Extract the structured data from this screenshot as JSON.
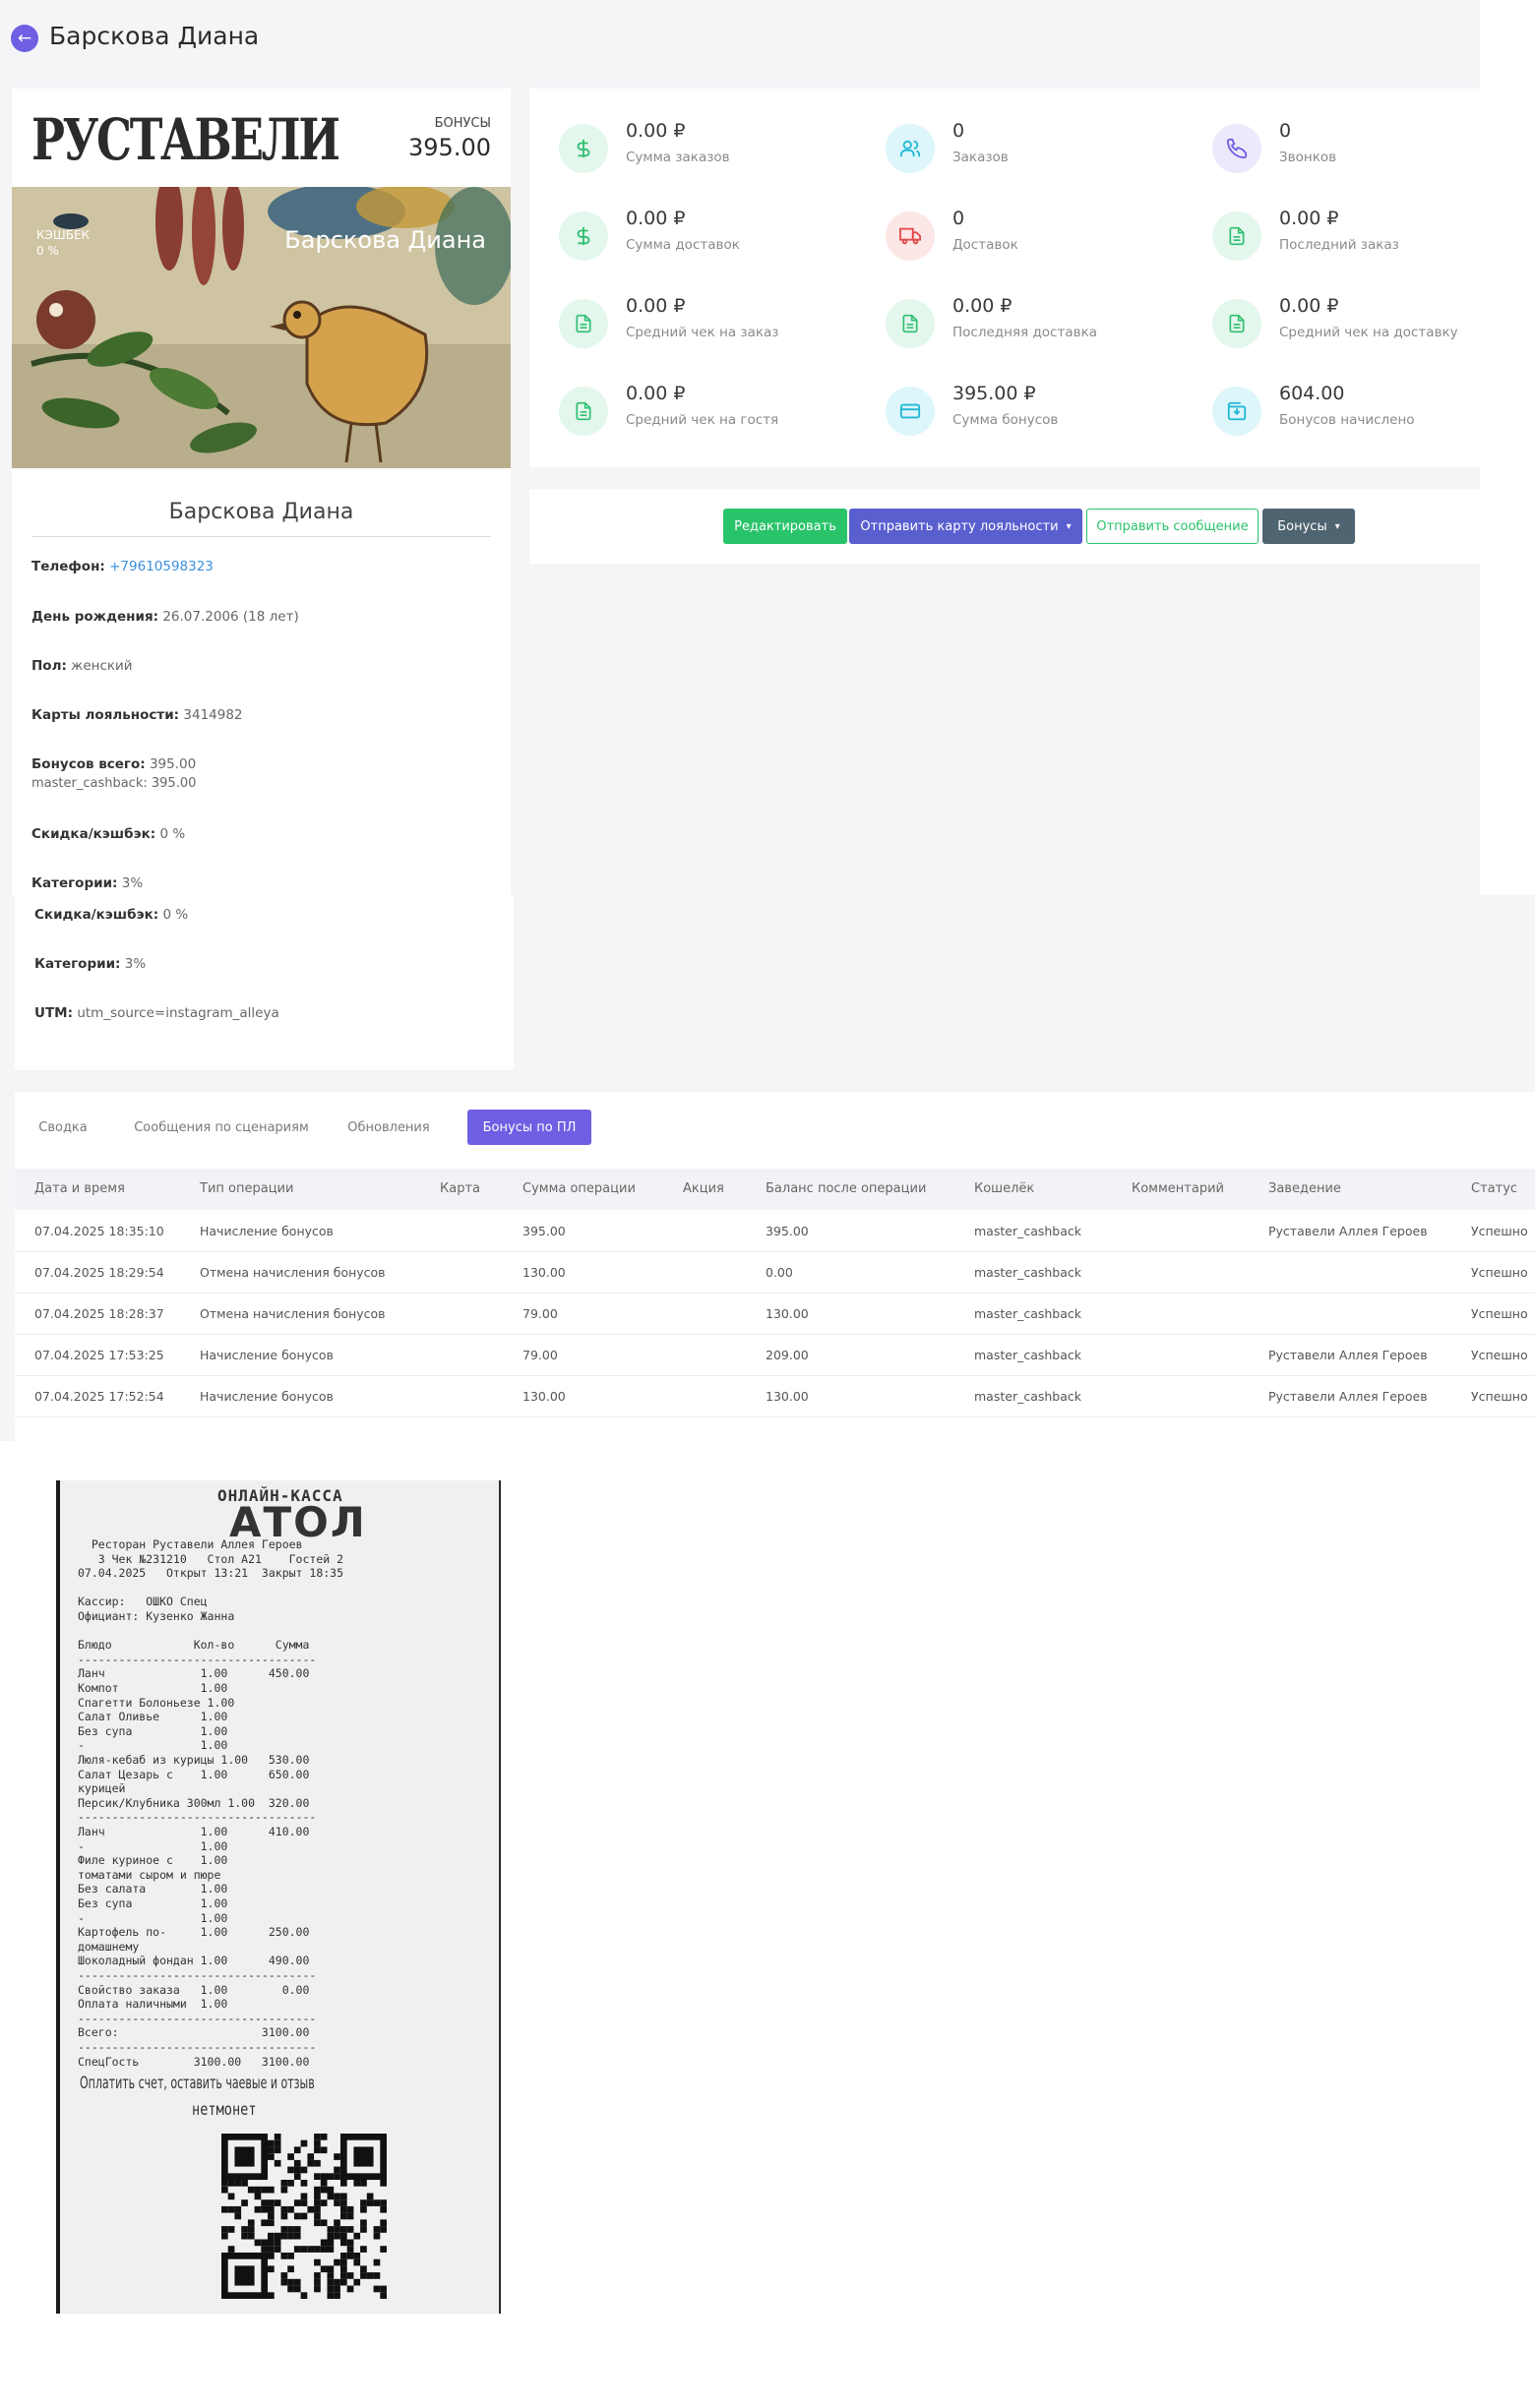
{
  "header": {
    "title": "Барскова Диана",
    "back_icon": "arrow-left-icon"
  },
  "loyalty_card": {
    "brand": "РУСТАВЕЛИ",
    "bonus_caption": "БОНУСЫ",
    "bonus_value": "395.00",
    "cashback_label": "КЭШБЕК",
    "cashback_value": "0 %",
    "holder": "Барскова Диана"
  },
  "profile": {
    "name": "Барскова Диана",
    "phone_label": "Телефон:",
    "phone": "+79610598323",
    "birthday_label": "День рождения:",
    "birthday": "26.07.2006 (18 лет)",
    "gender_label": "Пол:",
    "gender": "женский",
    "cards_label": "Карты лояльности:",
    "cards": "3414982",
    "bonus_total_label": "Бонусов всего:",
    "bonus_total": "395.00",
    "bonus_wallet": "master_cashback: 395.00",
    "discount_label": "Скидка/кэшбэк:",
    "discount": "0 %",
    "categories_label": "Категории:",
    "categories": "3%",
    "utm_label": "UTM:",
    "utm": "utm_source=instagram_alleya"
  },
  "stats": [
    {
      "value": "0.00 ₽",
      "label": "Сумма заказов",
      "icon": "dollar-icon",
      "color": "green"
    },
    {
      "value": "0",
      "label": "Заказов",
      "icon": "users-icon",
      "color": "cyan"
    },
    {
      "value": "0",
      "label": "Звонков",
      "icon": "phone-icon",
      "color": "purple"
    },
    {
      "value": "0.00 ₽",
      "label": "Сумма доставок",
      "icon": "dollar-icon",
      "color": "green"
    },
    {
      "value": "0",
      "label": "Доставок",
      "icon": "truck-icon",
      "color": "red"
    },
    {
      "value": "0.00 ₽",
      "label": "Последний заказ",
      "icon": "document-icon",
      "color": "green"
    },
    {
      "value": "0.00 ₽",
      "label": "Средний чек на заказ",
      "icon": "document-icon",
      "color": "green"
    },
    {
      "value": "0.00 ₽",
      "label": "Последняя доставка",
      "icon": "document-icon",
      "color": "green"
    },
    {
      "value": "0.00 ₽",
      "label": "Средний чек на доставку",
      "icon": "document-icon",
      "color": "green"
    },
    {
      "value": "0.00 ₽",
      "label": "Средний чек на гостя",
      "icon": "document-icon",
      "color": "green"
    },
    {
      "value": "395.00 ₽",
      "label": "Сумма бонусов",
      "icon": "credit-card-icon",
      "color": "cyan"
    },
    {
      "value": "604.00",
      "label": "Бонусов начислено",
      "icon": "wallet-icon",
      "color": "cyan"
    }
  ],
  "actions": {
    "edit": "Редактировать",
    "send_card": "Отправить карту лояльности",
    "send_message": "Отправить сообщение",
    "bonuses": "Бонусы"
  },
  "tabs": [
    "Сводка",
    "Сообщения по сценариям",
    "Обновления",
    "Бонусы по ПЛ"
  ],
  "table": {
    "columns": [
      "Дата и время",
      "Тип операции",
      "Карта",
      "Сумма операции",
      "Акция",
      "Баланс после операции",
      "Кошелёк",
      "Комментарий",
      "Заведение",
      "Статус"
    ],
    "rows": [
      [
        "07.04.2025 18:35:10",
        "Начисление бонусов",
        "",
        "395.00",
        "",
        "395.00",
        "master_cashback",
        "",
        "Руставели Аллея Героев",
        "Успешно"
      ],
      [
        "07.04.2025 18:29:54",
        "Отмена начисления бонусов",
        "",
        "130.00",
        "",
        "0.00",
        "master_cashback",
        "",
        "",
        "Успешно"
      ],
      [
        "07.04.2025 18:28:37",
        "Отмена начисления бонусов",
        "",
        "79.00",
        "",
        "130.00",
        "master_cashback",
        "",
        "",
        "Успешно"
      ],
      [
        "07.04.2025 17:53:25",
        "Начисление бонусов",
        "",
        "79.00",
        "",
        "209.00",
        "master_cashback",
        "",
        "Руставели Аллея Героев",
        "Успешно"
      ],
      [
        "07.04.2025 17:52:54",
        "Начисление бонусов",
        "",
        "130.00",
        "",
        "130.00",
        "master_cashback",
        "",
        "Руставели Аллея Героев",
        "Успешно"
      ]
    ]
  },
  "receipt": {
    "header": "ОНЛАЙН-КАССА",
    "logo": "АТОЛ",
    "lines": [
      "  Ресторан Руставели Аллея Героев",
      "   3 Чек №231210   Стол А21    Гостей 2",
      "07.04.2025   Открыт 13:21  Закрыт 18:35",
      "",
      "Кассир:   ОШКО Спец",
      "Официант: Кузенко Жанна",
      "",
      "Блюдо            Кол-во      Сумма",
      "-----------------------------------",
      "Ланч              1.00      450.00",
      "Компот            1.00",
      "Спагетти Болоньезе 1.00",
      "Салат Оливье      1.00",
      "Без супа          1.00",
      "-                 1.00",
      "Люля-кебаб из курицы 1.00   530.00",
      "Салат Цезарь с    1.00      650.00",
      "курицей",
      "Персик/Клубника 300мл 1.00  320.00",
      "-----------------------------------",
      "Ланч              1.00      410.00",
      "-                 1.00",
      "Филе куриное с    1.00",
      "томатами сыром и пюре",
      "Без салата        1.00",
      "Без супа          1.00",
      "-                 1.00",
      "Картофель по-     1.00      250.00",
      "домашнему",
      "Шоколадный фондан 1.00      490.00",
      "-----------------------------------",
      "Свойство заказа   1.00        0.00",
      "Оплата наличными  1.00",
      "-----------------------------------",
      "Всего:                     3100.00",
      "-----------------------------------",
      "СпецГость        3100.00   3100.00"
    ],
    "footer": "Оплатить счет, оставить чаевые и отзыв",
    "footer2": "нетмонет"
  }
}
